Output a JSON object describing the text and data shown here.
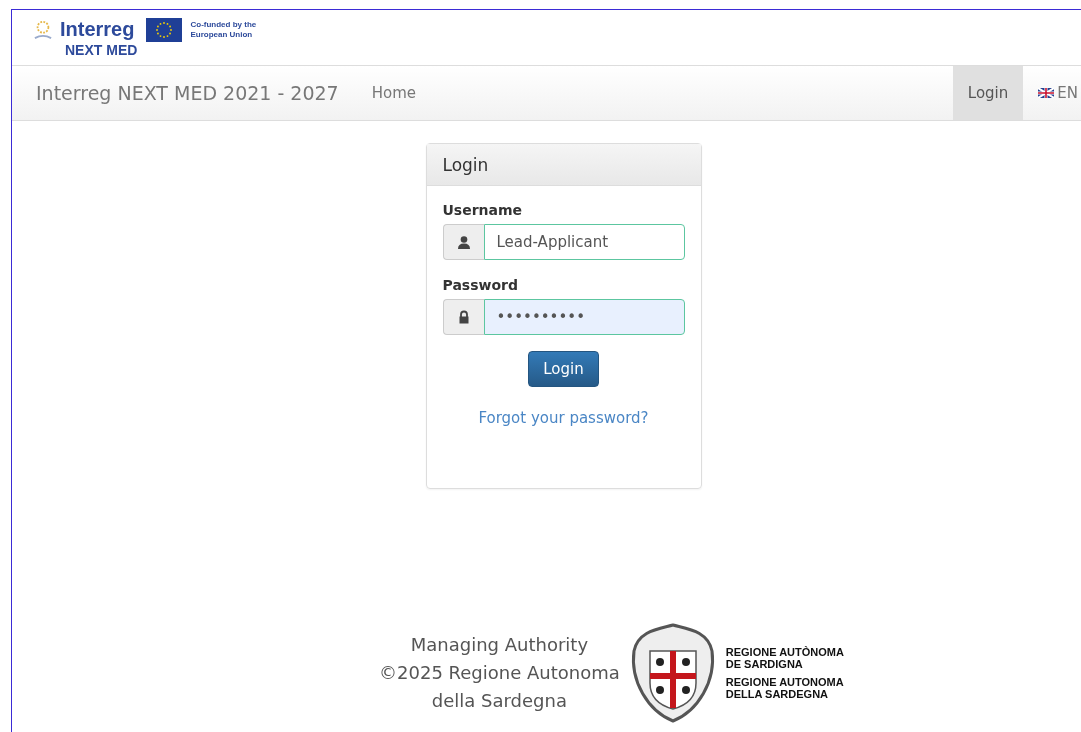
{
  "header": {
    "logo_word": "Interreg",
    "logo_sub": "NEXT MED",
    "eu_text": "Co-funded by the European Union"
  },
  "navbar": {
    "brand": "Interreg NEXT MED 2021 - 2027",
    "links": [
      {
        "label": "Home",
        "selected": false
      }
    ],
    "right_links": [
      {
        "label": "Login",
        "kind": "text",
        "selected": true
      },
      {
        "label": "EN",
        "kind": "flag",
        "selected": false
      }
    ]
  },
  "login_panel": {
    "title": "Login",
    "username_label": "Username",
    "username_value": "Lead-Applicant",
    "password_label": "Password",
    "password_value": "••••••••••",
    "button": "Login",
    "forgot_link": "Forgot your password?"
  },
  "footer": {
    "lines": [
      "Managing Authority",
      "©2025 Regione Autonoma",
      "della Sardegna"
    ],
    "region_lines": [
      "REGIONE AUTÒNOMA",
      "DE SARDIGNA",
      "REGIONE AUTONOMA",
      "DELLA SARDEGNA"
    ]
  }
}
